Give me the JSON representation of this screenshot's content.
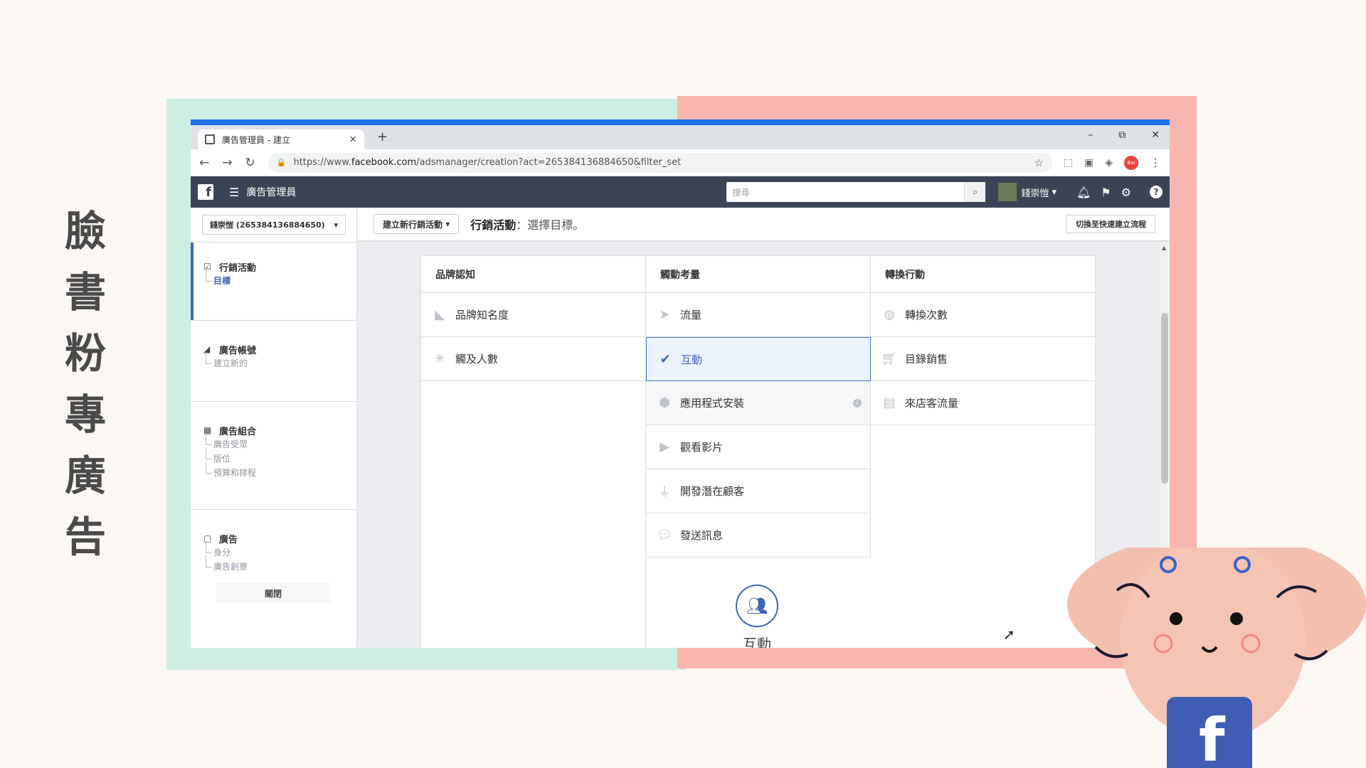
{
  "side_title": [
    "臉",
    "書",
    "粉",
    "專",
    "廣",
    "告"
  ],
  "browser": {
    "tab_title": "廣告管理員 - 建立",
    "tab_close": "×",
    "new_tab": "+",
    "window_controls": [
      "–",
      "⧉",
      "✕"
    ],
    "url_prefix": "https://www.",
    "url_host": "facebook.com",
    "url_path": "/adsmanager/creation?act=265384136884650&filter_set",
    "ext_avatar_label": "Bai"
  },
  "fb_bar": {
    "title": "廣告管理員",
    "search_placeholder": "搜尋",
    "user_name": "錢崇愷"
  },
  "left_panel": {
    "account": "錢崇愷 (265384136884650)",
    "sections": [
      {
        "title": "行銷活動",
        "items": [
          "目標"
        ]
      },
      {
        "title": "廣告帳號",
        "items": [
          "建立新的"
        ]
      },
      {
        "title": "廣告組合",
        "items": [
          "廣告受眾",
          "版位",
          "預算和排程"
        ]
      },
      {
        "title": "廣告",
        "items": [
          "身分",
          "廣告創意"
        ]
      }
    ],
    "close_label": "關閉"
  },
  "top_strip": {
    "new_campaign": "建立新行銷活動",
    "breadcrumb_strong": "行銷活動",
    "breadcrumb_rest": "：選擇目標。",
    "quick_create": "切換至快速建立流程"
  },
  "objectives": {
    "columns": [
      {
        "header": "品牌認知",
        "items": [
          "品牌知名度",
          "觸及人數"
        ]
      },
      {
        "header": "觸動考量",
        "items": [
          "流量",
          "互動",
          "應用程式安裝",
          "觀看影片",
          "開發潛在顧客",
          "發送訊息"
        ]
      },
      {
        "header": "轉換行動",
        "items": [
          "轉換次數",
          "目錄銷售",
          "來店客流量"
        ]
      }
    ],
    "selected": "互動",
    "detail_title": "互動"
  },
  "colors": {
    "fb_bar": "#3b4455",
    "fb_blue": "#4267b2",
    "frame_mint": "#cdeee2",
    "frame_pink": "#f7b7b0"
  }
}
